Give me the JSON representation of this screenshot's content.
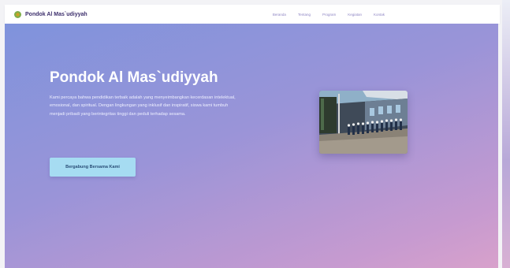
{
  "brand": {
    "name": "Pondok Al Mas`udiyyah",
    "logo_icon": "leaf-logo-icon"
  },
  "nav": {
    "links": [
      {
        "label": "Beranda"
      },
      {
        "label": "Tentang"
      },
      {
        "label": "Program"
      },
      {
        "label": "Kegiatan"
      },
      {
        "label": "Kontak"
      }
    ]
  },
  "hero": {
    "title": "Pondok Al Mas`udiyyah",
    "description": "Kami percaya bahwa pendidikan terbaik adalah yang menyeimbangkan kecerdasan intelektual, emosional, dan spiritual. Dengan lingkungan yang inklusif dan inspiratif, siswa kami tumbuh menjadi pribadi yang berintegritas tinggi dan peduli terhadap sesama.",
    "cta_label": "Bergabung Bersama Kami"
  },
  "colors": {
    "hero_gradient_start": "#7f93dc",
    "hero_gradient_end": "#d8a1cb",
    "cta_background": "#a6dcf2",
    "brand_text": "#3b2d6b"
  }
}
